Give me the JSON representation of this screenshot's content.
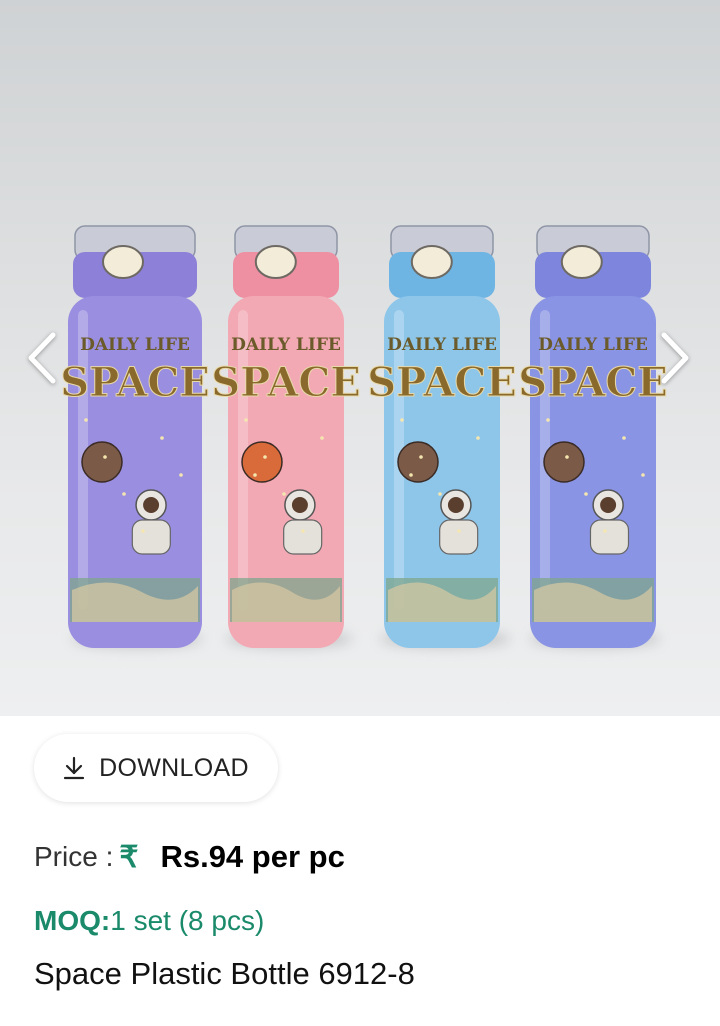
{
  "gallery": {
    "image_description_alt": "",
    "prev_icon": "chevron-left-icon",
    "next_icon": "chevron-right-icon",
    "bottles": [
      {
        "color": "#9a8ee0",
        "cap": "#8d80d8",
        "label_top": "DAILY LIFE",
        "label_main": "SPACE"
      },
      {
        "color": "#f2a9b4",
        "cap": "#ee8fa2",
        "label_top": "DAILY LIFE",
        "label_main": "SPACE"
      },
      {
        "color": "#8ec6ea",
        "cap": "#6fb5e4",
        "label_top": "DAILY LIFE",
        "label_main": "SPACE"
      },
      {
        "color": "#8a94e4",
        "cap": "#7d86dc",
        "label_top": "DAILY LIFE",
        "label_main": "SPACE"
      }
    ]
  },
  "download": {
    "label": "DOWNLOAD",
    "icon": "download-icon"
  },
  "price": {
    "label": "Price :",
    "currency_symbol": "₹",
    "value": "Rs.94 per pc"
  },
  "moq": {
    "key": "MOQ:",
    "value": "1 set (8 pcs)"
  },
  "product": {
    "title": "Space Plastic Bottle 6912-8"
  },
  "colors": {
    "accent": "#1a8a6a"
  }
}
